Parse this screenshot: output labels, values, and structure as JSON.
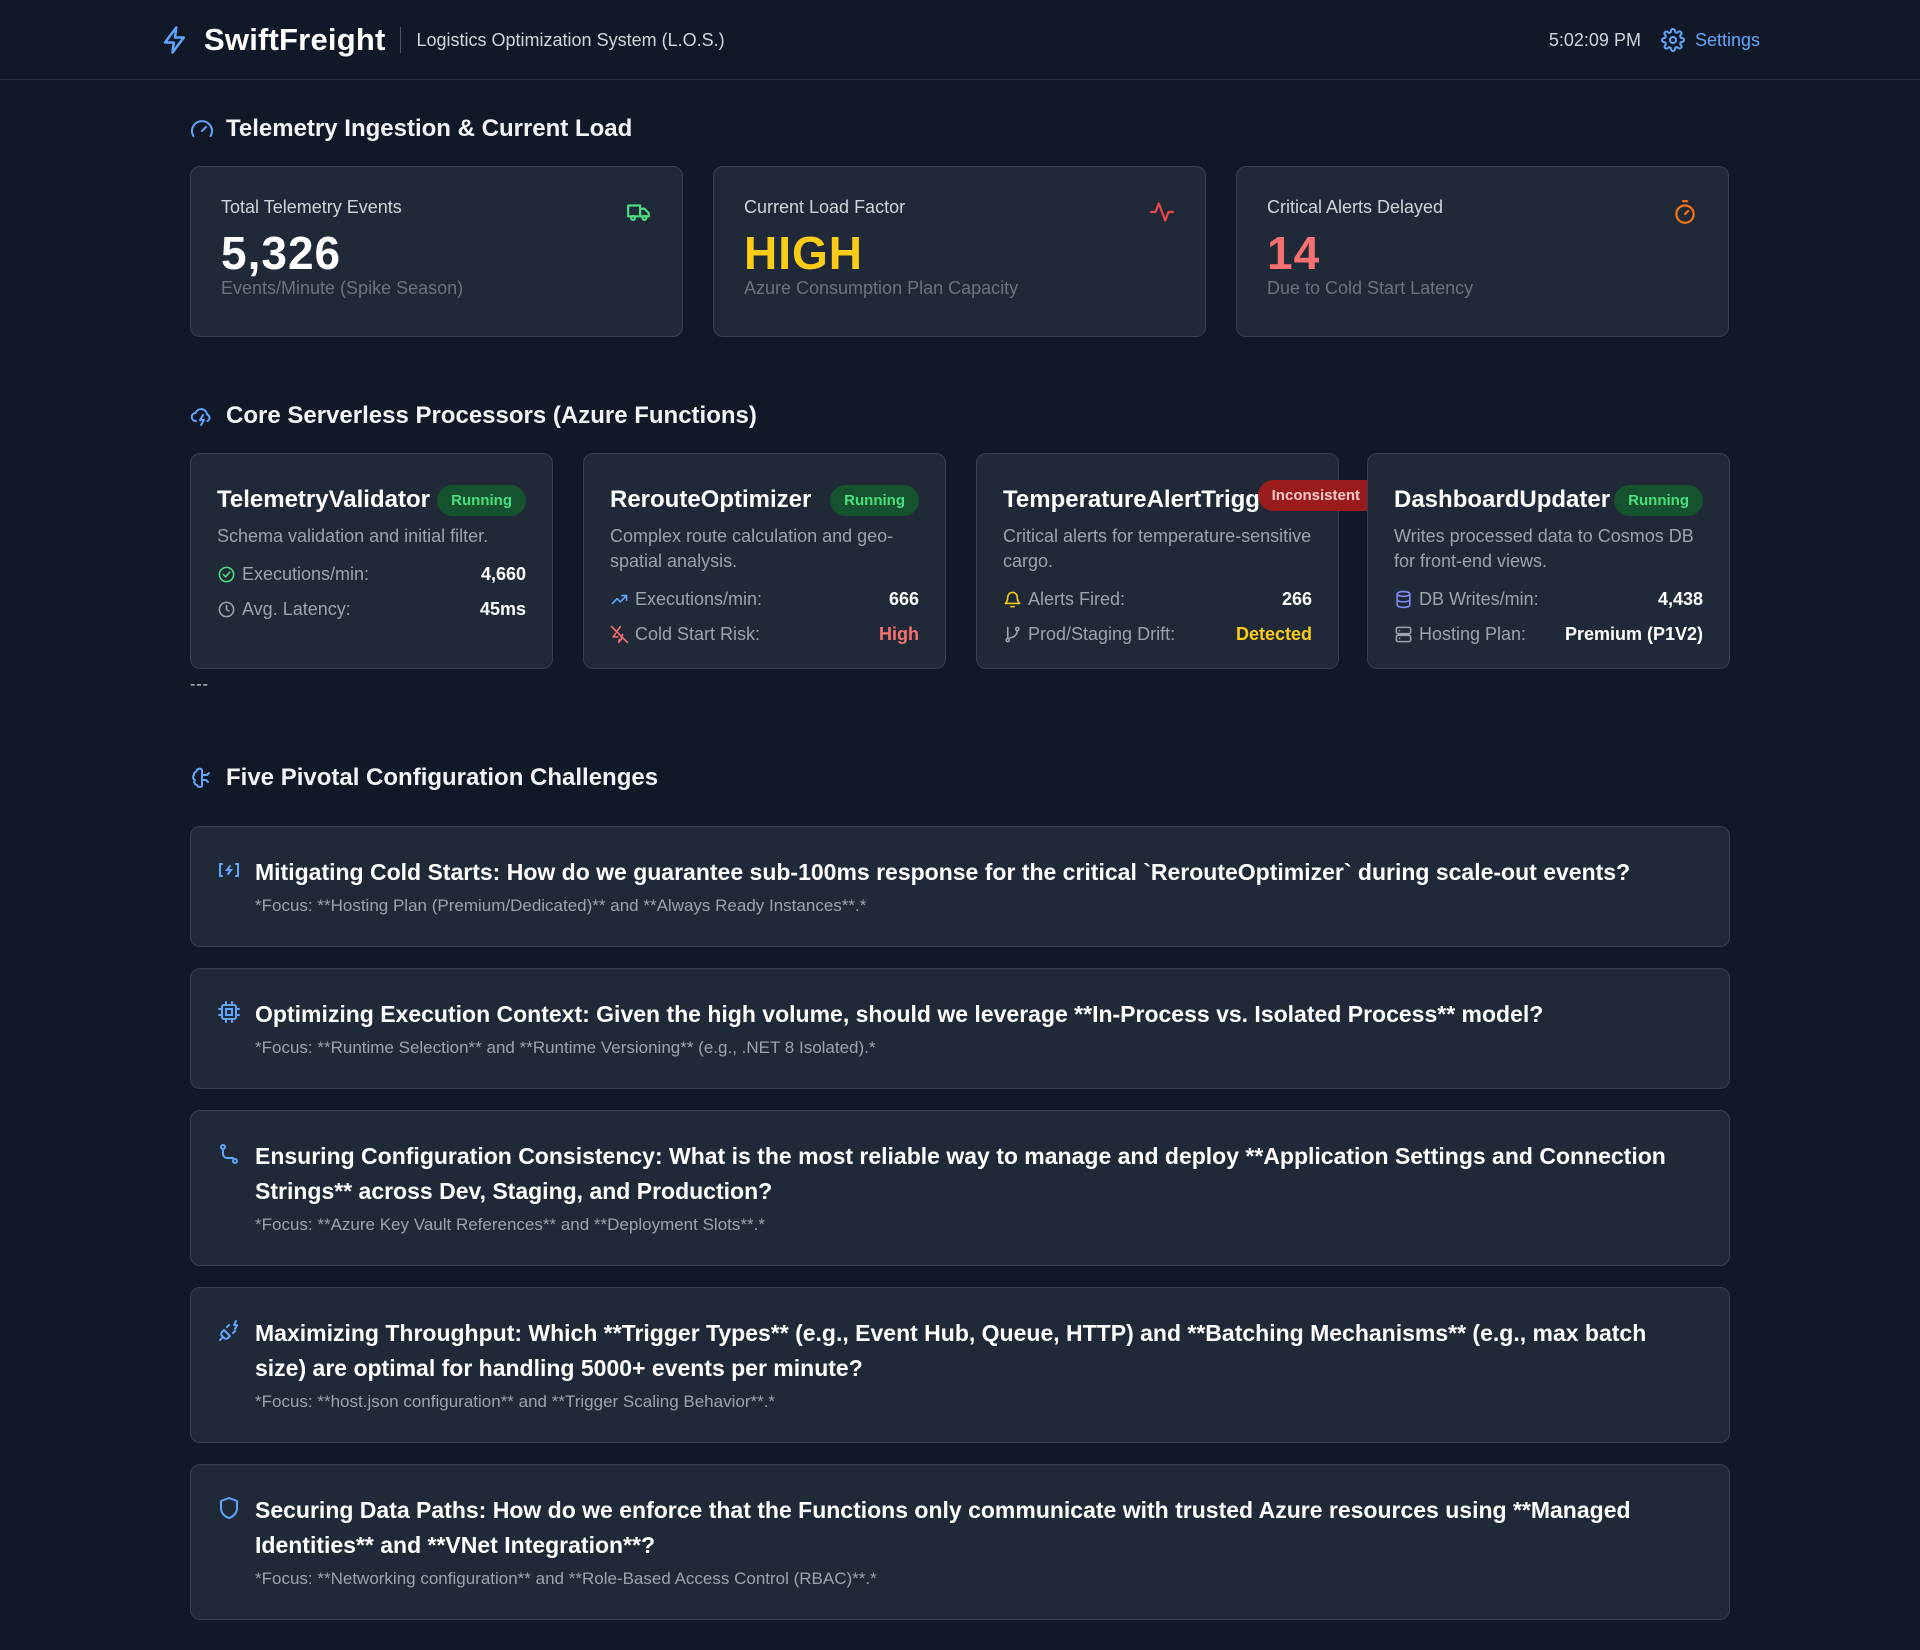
{
  "header": {
    "brand": "SwiftFreight",
    "subtitle": "Logistics Optimization System (L.O.S.)",
    "time": "5:02:09 PM",
    "settings_label": "Settings"
  },
  "telemetry": {
    "title": "Telemetry Ingestion & Current Load",
    "cards": [
      {
        "label": "Total Telemetry Events",
        "value": "5,326",
        "sub": "Events/Minute (Spike Season)",
        "color": "#ffffff",
        "icon": "truck-icon"
      },
      {
        "label": "Current Load Factor",
        "value": "HIGH",
        "sub": "Azure Consumption Plan Capacity",
        "color": "#facc15",
        "icon": "activity-icon"
      },
      {
        "label": "Critical Alerts Delayed",
        "value": "14",
        "sub": "Due to Cold Start Latency",
        "color": "#f87171",
        "icon": "timer-icon"
      }
    ]
  },
  "processors": {
    "title": "Core Serverless Processors (Azure Functions)",
    "functions": [
      {
        "name": "TelemetryValidator",
        "status": "Running",
        "desc": "Schema validation and initial filter.",
        "metrics": [
          {
            "label": "Executions/min:",
            "value": "4,660",
            "icon": "check-circle-icon",
            "icon_color": "#4ade80",
            "value_color": "#ffffff"
          },
          {
            "label": "Avg. Latency:",
            "value": "45ms",
            "icon": "clock-icon",
            "icon_color": "#9ca3af",
            "value_color": "#ffffff"
          }
        ]
      },
      {
        "name": "RerouteOptimizer",
        "status": "Running",
        "desc": "Complex route calculation and geo-spatial analysis.",
        "metrics": [
          {
            "label": "Executions/min:",
            "value": "666",
            "icon": "trending-up-icon",
            "icon_color": "#60a5fa",
            "value_color": "#ffffff"
          },
          {
            "label": "Cold Start Risk:",
            "value": "High",
            "icon": "zap-off-icon",
            "icon_color": "#f87171",
            "value_color": "#f87171"
          }
        ]
      },
      {
        "name": "TemperatureAlertTrigger",
        "status": "Inconsistent",
        "desc": "Critical alerts for temperature-sensitive cargo.",
        "metrics": [
          {
            "label": "Alerts Fired:",
            "value": "266",
            "icon": "bell-icon",
            "icon_color": "#facc15",
            "value_color": "#ffffff"
          },
          {
            "label": "Prod/Staging Drift:",
            "value": "Detected",
            "icon": "git-branch-icon",
            "icon_color": "#9ca3af",
            "value_color": "#facc15"
          }
        ]
      },
      {
        "name": "DashboardUpdater",
        "status": "Running",
        "desc": "Writes processed data to Cosmos DB for front-end views.",
        "metrics": [
          {
            "label": "DB Writes/min:",
            "value": "4,438",
            "icon": "database-icon",
            "icon_color": "#818cf8",
            "value_color": "#ffffff"
          },
          {
            "label": "Hosting Plan:",
            "value": "Premium (P1V2)",
            "icon": "server-icon",
            "icon_color": "#9ca3af",
            "value_color": "#ffffff"
          }
        ]
      }
    ]
  },
  "divider": "---",
  "challenges": {
    "title": "Five Pivotal Configuration Challenges",
    "items": [
      {
        "title": "Mitigating Cold Starts: How do we guarantee sub-100ms response for the critical `RerouteOptimizer` during scale-out events?",
        "focus": "*Focus: **Hosting Plan (Premium/Dedicated)** and **Always Ready Instances**.*",
        "icon": "power-bracket-icon"
      },
      {
        "title": "Optimizing Execution Context: Given the high volume, should we leverage **In-Process vs. Isolated Process** model?",
        "focus": "*Focus: **Runtime Selection** and **Runtime Versioning** (e.g., .NET 8 Isolated).*",
        "icon": "cpu-icon"
      },
      {
        "title": "Ensuring Configuration Consistency: What is the most reliable way to manage and deploy **Application Settings and Connection Strings** across Dev, Staging, and Production?",
        "focus": "*Focus: **Azure Key Vault References** and **Deployment Slots**.*",
        "icon": "route-icon"
      },
      {
        "title": "Maximizing Throughput: Which **Trigger Types** (e.g., Event Hub, Queue, HTTP) and **Batching Mechanisms** (e.g., max batch size) are optimal for handling 5000+ events per minute?",
        "focus": "*Focus: **host.json configuration** and **Trigger Scaling Behavior**.*",
        "icon": "plug-zap-icon"
      },
      {
        "title": "Securing Data Paths: How do we enforce that the Functions only communicate with trusted Azure resources using **Managed Identities** and **VNet Integration**?",
        "focus": "*Focus: **Networking configuration** and **Role-Based Access Control (RBAC)**.*",
        "icon": "shield-icon"
      }
    ]
  },
  "colors": {
    "background": "#111827",
    "card": "#1f2937",
    "accent": "#60a5fa",
    "running": "#4ade80",
    "inconsistent": "#991b1b"
  }
}
